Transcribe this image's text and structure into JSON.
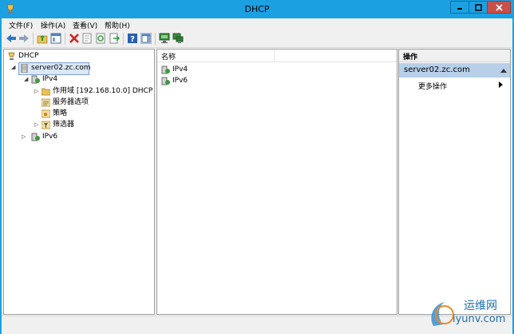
{
  "window": {
    "title": "DHCP"
  },
  "menubar": {
    "items": [
      "文件(F)",
      "操作(A)",
      "查看(V)",
      "帮助(H)"
    ]
  },
  "toolbar": {
    "icons": [
      "back-icon",
      "forward-icon",
      "up-folder-icon",
      "show-tree-icon",
      "delete-icon",
      "properties-icon",
      "refresh-icon",
      "export-icon",
      "help-icon",
      "show-action-pane-icon",
      "computer-icon",
      "network-icon"
    ]
  },
  "tree": {
    "root": "DHCP",
    "server": "server02.zc.com",
    "ipv4": "IPv4",
    "scope": "作用域 [192.168.10.0] DHCP",
    "server_options": "服务器选项",
    "policies": "策略",
    "filters": "筛选器",
    "ipv6": "IPv6"
  },
  "list": {
    "column_name": "名称",
    "rows": [
      "IPv4",
      "IPv6"
    ]
  },
  "actions": {
    "header": "操作",
    "server": "server02.zc.com",
    "more": "更多操作"
  },
  "watermark": {
    "text": "运维网",
    "url_text": "iyunv.com"
  },
  "colors": {
    "title_bar": "#1ba1e2",
    "close_button": "#c7504a",
    "selection": "#dbe7f6",
    "action_highlight": "#b7cfe8"
  }
}
